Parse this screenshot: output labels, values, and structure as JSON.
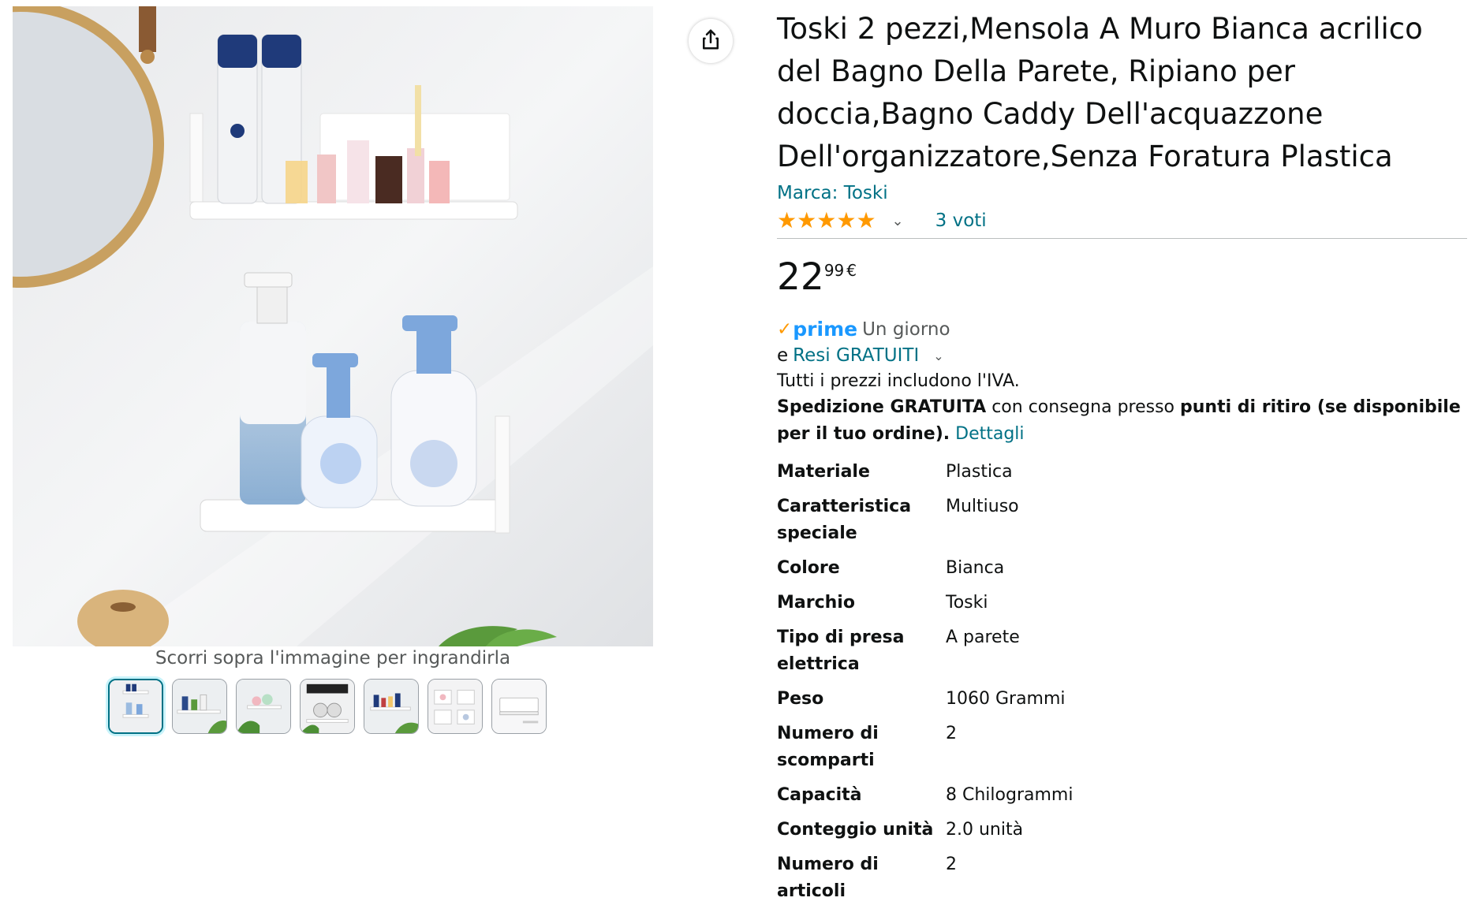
{
  "gallery": {
    "caption": "Scorri sopra l'immagine per ingrandirla",
    "main_image_alt": "Toski",
    "thumbnail_count": 7,
    "selected_thumbnail": 1
  },
  "share": {
    "icon": "share-icon"
  },
  "product": {
    "title": "Toski 2 pezzi,Mensola A Muro Bianca acrilico del Bagno Della Parete, Ripiano per doccia,Bagno Caddy Dell'acquazzone Dell'organizzatore,Senza Foratura Plastica",
    "brand_label": "Marca: Toski",
    "rating_stars": 5,
    "rating_count": "3 voti"
  },
  "price": {
    "whole": "22",
    "fraction": "99",
    "currency": "€"
  },
  "delivery": {
    "prime_word": "prime",
    "prime_text": "Un giorno",
    "returns_prefix": "e",
    "returns_link": "Resi GRATUITI",
    "tax_note": "Tutti i prezzi includono l'IVA.",
    "shipping_bold_1": "Spedizione GRATUITA",
    "shipping_mid": " con consegna presso ",
    "shipping_bold_2": "punti di ritiro (se disponibile per il tuo ordine).",
    "shipping_link": "Dettagli"
  },
  "specs": [
    {
      "key": "Materiale",
      "value": "Plastica"
    },
    {
      "key": "Caratteristica speciale",
      "value": "Multiuso"
    },
    {
      "key": "Colore",
      "value": "Bianca"
    },
    {
      "key": "Marchio",
      "value": "Toski"
    },
    {
      "key": "Tipo di presa elettrica",
      "value": "A parete"
    },
    {
      "key": "Peso",
      "value": "1060 Grammi"
    },
    {
      "key": "Numero di scomparti",
      "value": "2"
    },
    {
      "key": "Capacità",
      "value": "8 Chilogrammi"
    },
    {
      "key": "Conteggio unità",
      "value": "2.0 unità"
    },
    {
      "key": "Numero di articoli",
      "value": "2"
    }
  ],
  "colors": {
    "link": "#007185",
    "star": "#ff9900",
    "prime": "#1a98ff",
    "text": "#0f1111",
    "muted": "#565959"
  }
}
